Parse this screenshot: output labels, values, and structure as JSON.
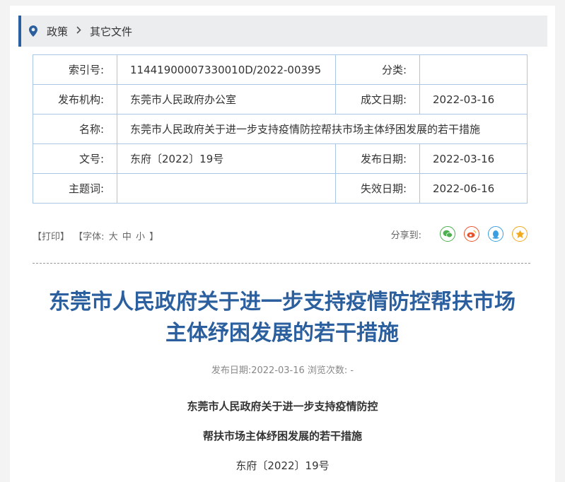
{
  "breadcrumb": {
    "items": [
      "政策",
      "其它文件"
    ]
  },
  "meta": {
    "index_label": "索引号:",
    "index_value": "11441900007330010D/2022-00395",
    "category_label": "分类:",
    "category_value": "",
    "issuer_label": "发布机构:",
    "issuer_value": "东莞市人民政府办公室",
    "written_date_label": "成文日期:",
    "written_date_value": "2022-03-16",
    "name_label": "名称:",
    "name_value": "东莞市人民政府关于进一步支持疫情防控帮扶市场主体纾困发展的若干措施",
    "doc_no_label": "文号:",
    "doc_no_value": "东府〔2022〕19号",
    "publish_date_label": "发布日期:",
    "publish_date_value": "2022-03-16",
    "keywords_label": "主题词:",
    "keywords_value": "",
    "expiry_label": "失效日期:",
    "expiry_value": "2022-06-16"
  },
  "toolbar": {
    "print": "【打印】",
    "font_prefix": "【字体:",
    "font_large": "大",
    "font_medium": "中",
    "font_small": "小",
    "font_suffix": "】",
    "share_label": "分享到:",
    "share_icons": [
      "wechat-icon",
      "weibo-icon",
      "qq-icon",
      "qzone-icon"
    ]
  },
  "article": {
    "title_line1": "东莞市人民政府关于进一步支持疫情防控帮扶市场",
    "title_line2": "主体纾困发展的若干措施",
    "pub_info": "发布日期:2022-03-16  浏览次数: -",
    "sub_line1": "东莞市人民政府关于进一步支持疫情防控",
    "sub_line2": "帮扶市场主体纾困发展的若干措施",
    "doc_no": "东府〔2022〕19号"
  },
  "colors": {
    "accent": "#2b5f9e",
    "table_border": "#a9c6e6",
    "wechat": "#4caf50",
    "weibo": "#e8542d",
    "qq": "#3a9ee0",
    "qzone": "#f0a81c"
  }
}
